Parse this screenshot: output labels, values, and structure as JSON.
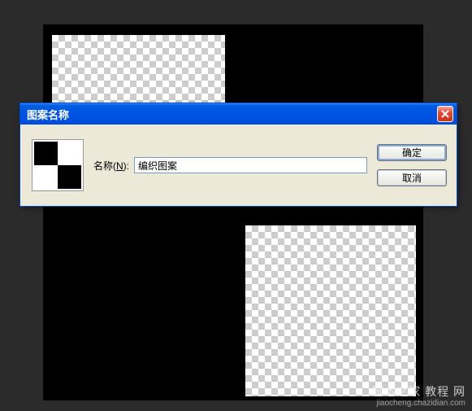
{
  "dialog": {
    "title": "图案名称",
    "name_label_prefix": "名称(",
    "name_label_key": "N",
    "name_label_suffix": "):",
    "name_value": "编织图案",
    "ok_label": "确定",
    "cancel_label": "取消"
  },
  "watermark": {
    "line1": "脚本之家 教程 网",
    "line2": "jiaocheng.chazidian.com"
  }
}
